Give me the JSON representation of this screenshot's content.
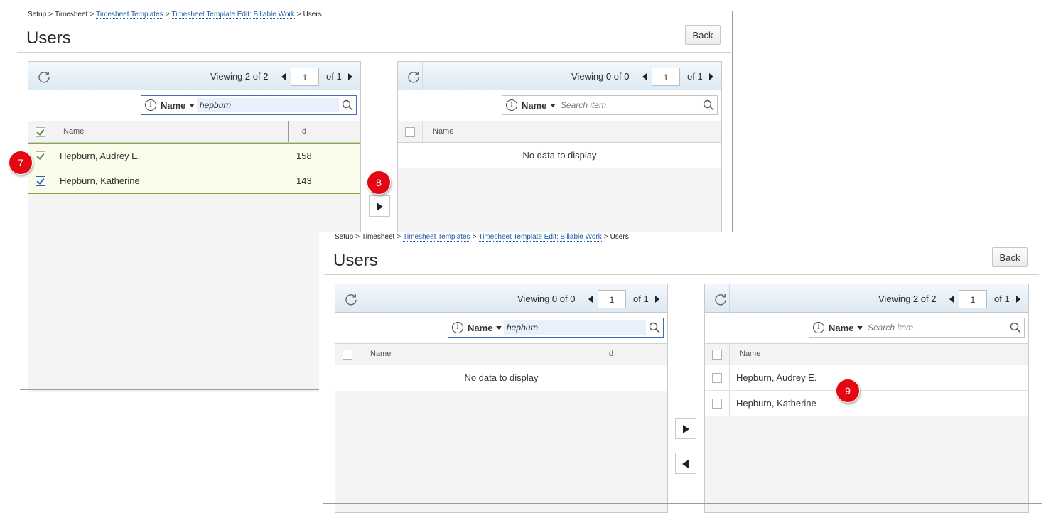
{
  "step_badges": [
    "7",
    "8",
    "9"
  ],
  "before": {
    "breadcrumb": {
      "items": [
        "Setup",
        "Timesheet",
        "Timesheet Templates",
        "Timesheet Template Edit: Billable Work",
        "Users"
      ],
      "separator": ">"
    },
    "page_title": "Users",
    "back_label": "Back",
    "left_panel": {
      "viewing_label": "Viewing",
      "viewing_count": "2",
      "viewing_of": "of",
      "viewing_total": "2",
      "page": "1",
      "of_pages": "of 1",
      "search_field": "Name",
      "search_value": "hepburn",
      "columns": [
        "Name",
        "Id"
      ],
      "rows": [
        {
          "name": "Hepburn, Audrey E.",
          "id": "158",
          "checked": true
        },
        {
          "name": "Hepburn, Katherine",
          "id": "143",
          "checked": true
        }
      ]
    },
    "right_panel": {
      "viewing_label": "Viewing",
      "viewing_count": "0",
      "viewing_of": "of",
      "viewing_total": "0",
      "page": "1",
      "of_pages": "of 1",
      "search_field": "Name",
      "search_placeholder": "Search item",
      "columns": [
        "Name"
      ],
      "empty_text": "No data to display"
    }
  },
  "after": {
    "breadcrumb": {
      "items": [
        "Setup",
        "Timesheet",
        "Timesheet Templates",
        "Timesheet Template Edit: Billable Work",
        "Users"
      ],
      "separator": ">"
    },
    "page_title": "Users",
    "back_label": "Back",
    "left_panel": {
      "viewing_label": "Viewing",
      "viewing_count": "0",
      "viewing_of": "of",
      "viewing_total": "0",
      "page": "1",
      "of_pages": "of 1",
      "search_field": "Name",
      "search_value": "hepburn",
      "columns": [
        "Name",
        "Id"
      ],
      "empty_text": "No data to display"
    },
    "right_panel": {
      "viewing_label": "Viewing",
      "viewing_count": "2",
      "viewing_of": "of",
      "viewing_total": "2",
      "page": "1",
      "of_pages": "of 1",
      "search_field": "Name",
      "search_placeholder": "Search item",
      "columns": [
        "Name"
      ],
      "rows": [
        {
          "name": "Hepburn, Audrey E.",
          "checked": false
        },
        {
          "name": "Hepburn, Katherine",
          "checked": false
        }
      ]
    }
  },
  "colors": {
    "accent_link": "#1f5aa6",
    "selected_row_bg": "#fbfbe9",
    "selected_row_border": "#7faa46",
    "badge": "#e30613"
  },
  "icons": [
    "refresh-icon",
    "info-icon",
    "search-icon",
    "chevron-down-icon",
    "arrow-left-icon",
    "arrow-right-icon",
    "move-right-icon",
    "move-left-icon",
    "checkmark-icon"
  ]
}
